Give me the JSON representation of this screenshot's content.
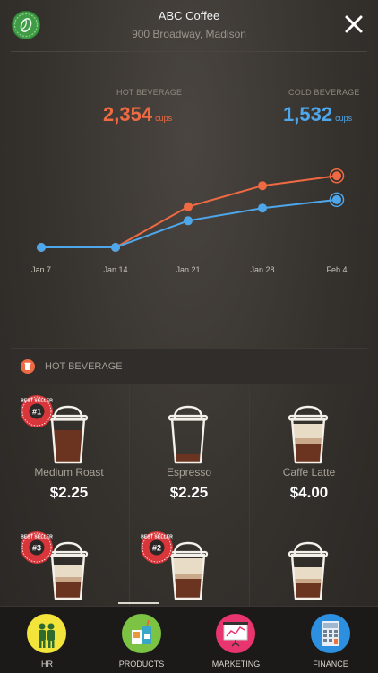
{
  "header": {
    "title": "ABC Coffee",
    "subtitle": "900 Broadway, Madison",
    "logo_icon": "coffee-bean-icon",
    "close_icon": "close-icon"
  },
  "stats": {
    "hot": {
      "label": "HOT BEVERAGE",
      "value": "2,354",
      "unit": "cups",
      "color": "#ef6a43"
    },
    "cold": {
      "label": "COLD BEVERAGE",
      "value": "1,532",
      "unit": "cups",
      "color": "#4ea7ea"
    }
  },
  "chart_data": {
    "type": "line",
    "x": [
      "Jan 7",
      "Jan 14",
      "Jan 21",
      "Jan 28",
      "Feb 4"
    ],
    "series": [
      {
        "name": "HOT BEVERAGE",
        "color": "#ef6a43",
        "values": [
          0,
          0,
          58,
          88,
          102
        ]
      },
      {
        "name": "COLD BEVERAGE",
        "color": "#4ea7ea",
        "values": [
          0,
          0,
          38,
          56,
          68
        ]
      }
    ],
    "ylim": [
      0,
      110
    ],
    "grid": false,
    "legend": "none"
  },
  "section": {
    "label": "HOT BEVERAGE",
    "icon": "hot-cup-icon",
    "color": "#ef6a43"
  },
  "products": [
    {
      "name": "Medium Roast",
      "price": "$2.25",
      "badge": "#1",
      "badge_text": "BEST SELLER",
      "fill": 0.72,
      "style": "dark"
    },
    {
      "name": "Espresso",
      "price": "$2.25",
      "badge": "",
      "badge_text": "",
      "fill": 0.18,
      "style": "dark"
    },
    {
      "name": "Caffe Latte",
      "price": "$4.00",
      "badge": "",
      "badge_text": "",
      "fill": 0.85,
      "style": "latte"
    },
    {
      "name": "",
      "price": "",
      "badge": "#3",
      "badge_text": "BEST SELLER",
      "fill": 0.75,
      "style": "latte"
    },
    {
      "name": "",
      "price": "",
      "badge": "#2",
      "badge_text": "BEST SELLER",
      "fill": 0.9,
      "style": "latte"
    },
    {
      "name": "",
      "price": "",
      "badge": "",
      "badge_text": "",
      "fill": 0.7,
      "style": "latte"
    }
  ],
  "tabs": [
    {
      "label": "HR",
      "icon": "people-icon",
      "color": "#f2e43a"
    },
    {
      "label": "PRODUCTS",
      "icon": "drinks-icon",
      "color": "#7cc243",
      "active": true
    },
    {
      "label": "MARKETING",
      "icon": "presentation-chart-icon",
      "color": "#e8346f"
    },
    {
      "label": "FINANCE",
      "icon": "calculator-icon",
      "color": "#2d8fe0"
    }
  ]
}
